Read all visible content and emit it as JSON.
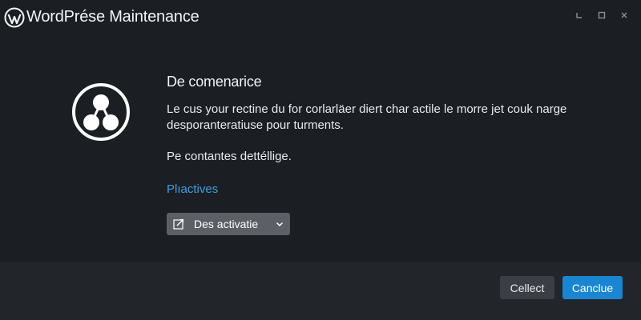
{
  "window": {
    "title": "WordPrése Maintenance",
    "logo_icon": "wordpress-logo-icon",
    "controls": [
      "minimize-icon",
      "maximize-icon",
      "close-icon"
    ]
  },
  "dialog": {
    "icon": "share-nodes-icon",
    "heading": "De comenarice",
    "body": "Le cus your rectine du for corlarläer diert char actile le morre jet couk narge desporanteratiuse pour turments.",
    "note": "Pe contantes dettéllige.",
    "link_label": "Plıactives",
    "dropdown": {
      "icon": "edit-icon",
      "selected": "Des activatie",
      "chevron_icon": "chevron-down-icon"
    }
  },
  "footer": {
    "secondary_label": "Cellect",
    "primary_label": "Canclue"
  },
  "colors": {
    "background": "#1b1e23",
    "footer": "#222529",
    "link": "#3e9ee3",
    "primary_button": "#1a86d1",
    "secondary_button": "#3b3f45",
    "dropdown": "#5c6066"
  }
}
